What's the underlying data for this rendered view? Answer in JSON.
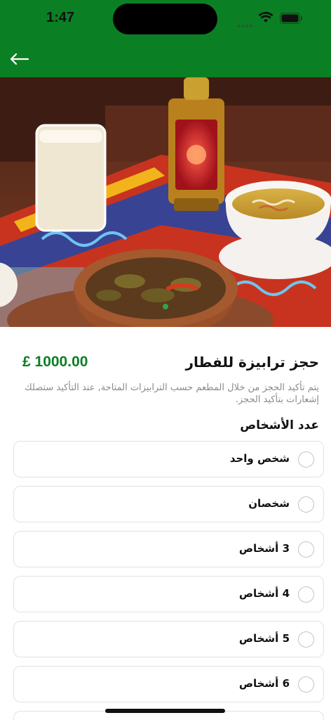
{
  "status_bar": {
    "time": "1:47",
    "icons": [
      "signal-dots-icon",
      "wifi-icon",
      "battery-icon"
    ]
  },
  "header": {
    "back_icon": "arrow-left-icon",
    "background_color": "#0b7f24"
  },
  "hero_image": {
    "subject": "ramadan-iftar-table-photo"
  },
  "product": {
    "title": "حجز ترابيزة للفطار",
    "price": "£ 1000.00",
    "price_color": "#0b7f24",
    "description": "يتم تأكيد الحجز من خلال المطعم حسب الترابيزات المتاحة, عند التأكيد ستصلك إشعارات بتأكيد الحجز."
  },
  "guests": {
    "label": "عدد الأشخاص",
    "options": [
      {
        "label": "شخص واحد",
        "selected": false
      },
      {
        "label": "شخصان",
        "selected": false
      },
      {
        "label": "3 أشخاص",
        "selected": false
      },
      {
        "label": "4 أشخاص",
        "selected": false
      },
      {
        "label": "5 أشخاص",
        "selected": false
      },
      {
        "label": "6 أشخاص",
        "selected": false
      }
    ]
  }
}
